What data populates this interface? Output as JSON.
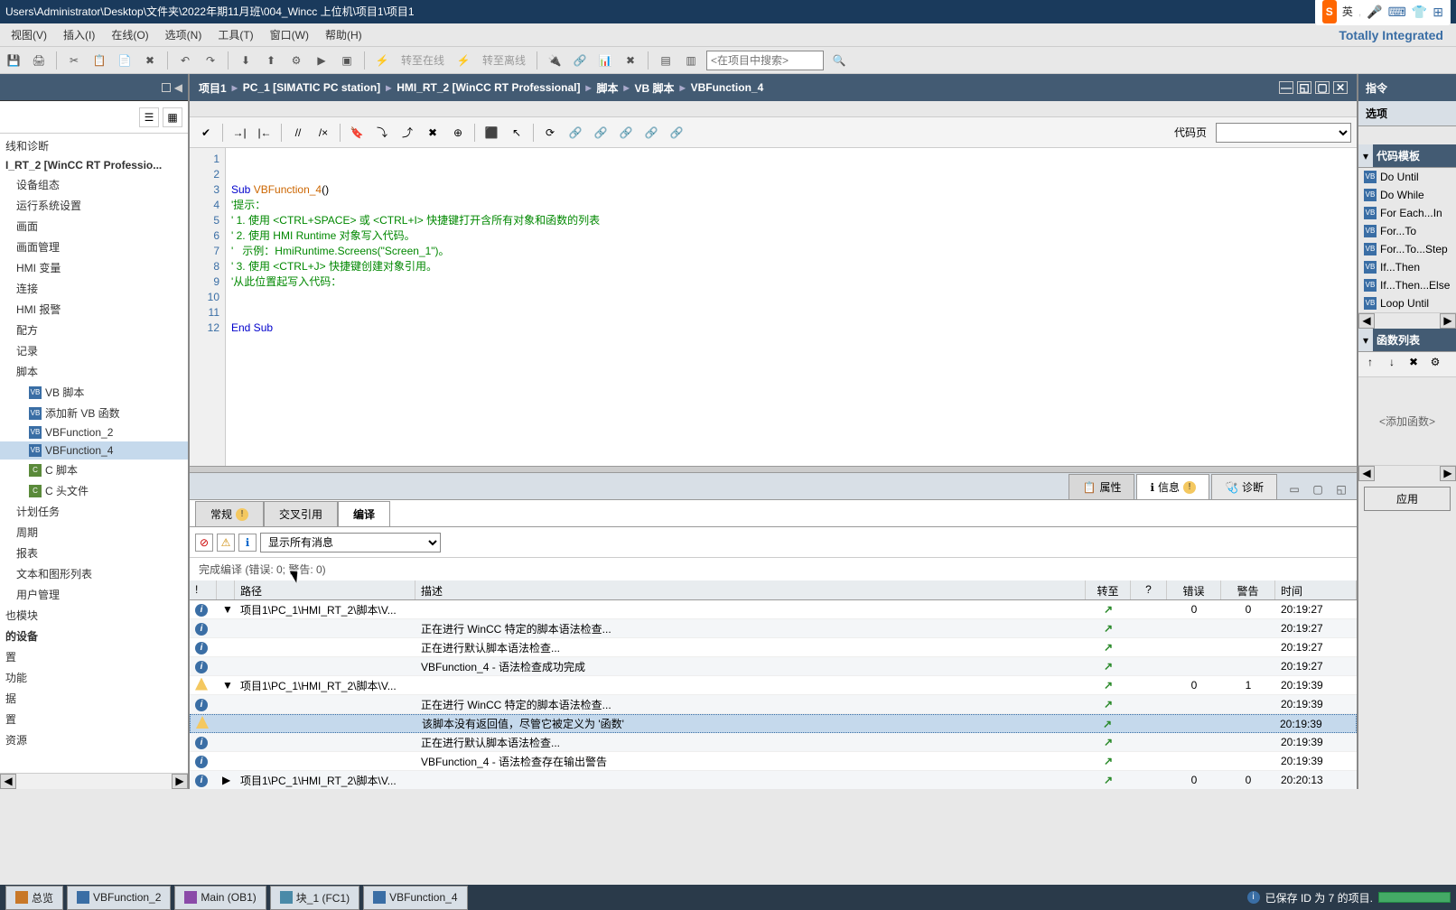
{
  "titlebar": {
    "path": "Users\\Administrator\\Desktop\\文件夹\\2022年期11月班\\004_Wincc 上位机\\项目1\\项目1"
  },
  "ime": {
    "lang": "英",
    "glyphs": [
      "、",
      "🎤",
      "⌨",
      "👕",
      "⊞"
    ]
  },
  "menubar": {
    "items": [
      "视图(V)",
      "插入(I)",
      "在线(O)",
      "选项(N)",
      "工具(T)",
      "窗口(W)",
      "帮助(H)"
    ]
  },
  "brand": "Totally Integrated",
  "toolbar_main": {
    "search_placeholder": "<在项目中搜索>",
    "online_label": "转至在线",
    "offline_label": "转至离线"
  },
  "breadcrumb": [
    "项目1",
    "PC_1 [SIMATIC PC station]",
    "HMI_RT_2 [WinCC RT Professional]",
    "脚本",
    "VB 脚本",
    "VBFunction_4"
  ],
  "sidebar_left": {
    "items": [
      {
        "label": "线和诊断",
        "cls": ""
      },
      {
        "label": "I_RT_2 [WinCC RT Professio...",
        "cls": "bold"
      },
      {
        "label": "设备组态",
        "cls": "sub1"
      },
      {
        "label": "运行系统设置",
        "cls": "sub1"
      },
      {
        "label": "画面",
        "cls": "sub1"
      },
      {
        "label": "画面管理",
        "cls": "sub1"
      },
      {
        "label": "HMI 变量",
        "cls": "sub1"
      },
      {
        "label": "连接",
        "cls": "sub1"
      },
      {
        "label": "HMI 报警",
        "cls": "sub1"
      },
      {
        "label": "配方",
        "cls": "sub1"
      },
      {
        "label": "记录",
        "cls": "sub1"
      },
      {
        "label": "脚本",
        "cls": "sub1"
      },
      {
        "label": "VB 脚本",
        "cls": "sub2",
        "icon": "vb"
      },
      {
        "label": "添加新 VB 函数",
        "cls": "sub2",
        "icon": "vb"
      },
      {
        "label": "VBFunction_2",
        "cls": "sub2",
        "icon": "vb"
      },
      {
        "label": "VBFunction_4",
        "cls": "sub2 selected",
        "icon": "vb"
      },
      {
        "label": "C 脚本",
        "cls": "sub2",
        "icon": "c"
      },
      {
        "label": "C 头文件",
        "cls": "sub2",
        "icon": "c"
      },
      {
        "label": "计划任务",
        "cls": "sub1"
      },
      {
        "label": "周期",
        "cls": "sub1"
      },
      {
        "label": "报表",
        "cls": "sub1"
      },
      {
        "label": "文本和图形列表",
        "cls": "sub1"
      },
      {
        "label": "用户管理",
        "cls": "sub1"
      },
      {
        "label": "也模块",
        "cls": ""
      },
      {
        "label": "的设备",
        "cls": "bold"
      },
      {
        "label": "置",
        "cls": ""
      },
      {
        "label": "功能",
        "cls": ""
      },
      {
        "label": "据",
        "cls": ""
      },
      {
        "label": "置",
        "cls": ""
      },
      {
        "label": "资源",
        "cls": ""
      }
    ]
  },
  "code": {
    "codepage_label": "代码页",
    "lines": [
      {
        "n": 1,
        "text": ""
      },
      {
        "n": 2,
        "text": ""
      },
      {
        "n": 3,
        "html": "<span class='kw'>Sub</span> <span class='fn'>VBFunction_4</span>()"
      },
      {
        "n": 4,
        "html": "<span class='cm'>'提示：</span>"
      },
      {
        "n": 5,
        "html": "<span class='cm'>' 1. 使用 &lt;CTRL+SPACE&gt; 或 &lt;CTRL+I&gt; 快捷键打开含所有对象和函数的列表</span>"
      },
      {
        "n": 6,
        "html": "<span class='cm'>' 2. 使用 HMI Runtime 对象写入代码。</span>"
      },
      {
        "n": 7,
        "html": "<span class='cm'>'   示例：HmiRuntime.Screens(\"Screen_1\")。</span>"
      },
      {
        "n": 8,
        "html": "<span class='cm'>' 3. 使用 &lt;CTRL+J&gt; 快捷键创建对象引用。</span>"
      },
      {
        "n": 9,
        "html": "<span class='cm'>'从此位置起写入代码：</span>"
      },
      {
        "n": 10,
        "text": ""
      },
      {
        "n": 11,
        "text": ""
      },
      {
        "n": 12,
        "html": "<span class='kw'>End Sub</span>"
      }
    ]
  },
  "lower_tabs": {
    "prop": "属性",
    "info": "信息",
    "diag": "诊断"
  },
  "sub_tabs": {
    "general": "常规",
    "xref": "交叉引用",
    "compile": "编译"
  },
  "filter": {
    "show_all": "显示所有消息"
  },
  "compile_summary": "完成编译 (错误: 0; 警告: 0)",
  "msg_cols": {
    "path": "路径",
    "desc": "描述",
    "goto": "转至",
    "q": "?",
    "err": "错误",
    "warn": "警告",
    "time": "时间"
  },
  "msgs": [
    {
      "icon": "info",
      "exp": "▼",
      "path": "项目1\\PC_1\\HMI_RT_2\\脚本\\V...",
      "desc": "",
      "goto": "↗",
      "err": "0",
      "warn": "0",
      "time": "20:19:27"
    },
    {
      "icon": "info",
      "exp": "",
      "path": "",
      "desc": "正在进行 WinCC 特定的脚本语法检查...",
      "goto": "↗",
      "err": "",
      "warn": "",
      "time": "20:19:27"
    },
    {
      "icon": "info",
      "exp": "",
      "path": "",
      "desc": "正在进行默认脚本语法检查...",
      "goto": "↗",
      "err": "",
      "warn": "",
      "time": "20:19:27"
    },
    {
      "icon": "info",
      "exp": "",
      "path": "",
      "desc": "VBFunction_4 - 语法检查成功完成",
      "goto": "↗",
      "err": "",
      "warn": "",
      "time": "20:19:27"
    },
    {
      "icon": "warn",
      "exp": "▼",
      "path": "项目1\\PC_1\\HMI_RT_2\\脚本\\V...",
      "desc": "",
      "goto": "↗",
      "err": "0",
      "warn": "1",
      "time": "20:19:39"
    },
    {
      "icon": "info",
      "exp": "",
      "path": "",
      "desc": "正在进行 WinCC 特定的脚本语法检查...",
      "goto": "↗",
      "err": "",
      "warn": "",
      "time": "20:19:39"
    },
    {
      "icon": "warn",
      "exp": "",
      "path": "",
      "desc": "该脚本没有返回值，尽管它被定义为 '函数'",
      "goto": "↗",
      "err": "",
      "warn": "",
      "time": "20:19:39",
      "selected": true
    },
    {
      "icon": "info",
      "exp": "",
      "path": "",
      "desc": "正在进行默认脚本语法检查...",
      "goto": "↗",
      "err": "",
      "warn": "",
      "time": "20:19:39"
    },
    {
      "icon": "info",
      "exp": "",
      "path": "",
      "desc": "VBFunction_4 - 语法检查存在输出警告",
      "goto": "↗",
      "err": "",
      "warn": "",
      "time": "20:19:39"
    },
    {
      "icon": "info",
      "exp": "▶",
      "path": "项目1\\PC_1\\HMI_RT_2\\脚本\\V...",
      "desc": "",
      "goto": "↗",
      "err": "0",
      "warn": "0",
      "time": "20:20:13"
    }
  ],
  "right": {
    "title": "指令",
    "options": "选项",
    "code_tpl": "代码模板",
    "fn_list": "函数列表",
    "add_new": "<添加函数>",
    "apply": "应用",
    "templates": [
      "Do Until",
      "Do While",
      "For Each...In",
      "For...To",
      "For...To...Step",
      "If...Then",
      "If...Then...Else",
      "Loop Until"
    ]
  },
  "taskbar": {
    "items": [
      {
        "icon": "ov",
        "label": "总览"
      },
      {
        "icon": "vb",
        "label": "VBFunction_2"
      },
      {
        "icon": "ob",
        "label": "Main (OB1)"
      },
      {
        "icon": "fc",
        "label": "块_1 (FC1)"
      },
      {
        "icon": "vb",
        "label": "VBFunction_4"
      }
    ],
    "status": "已保存 ID 为 7 的项目."
  }
}
